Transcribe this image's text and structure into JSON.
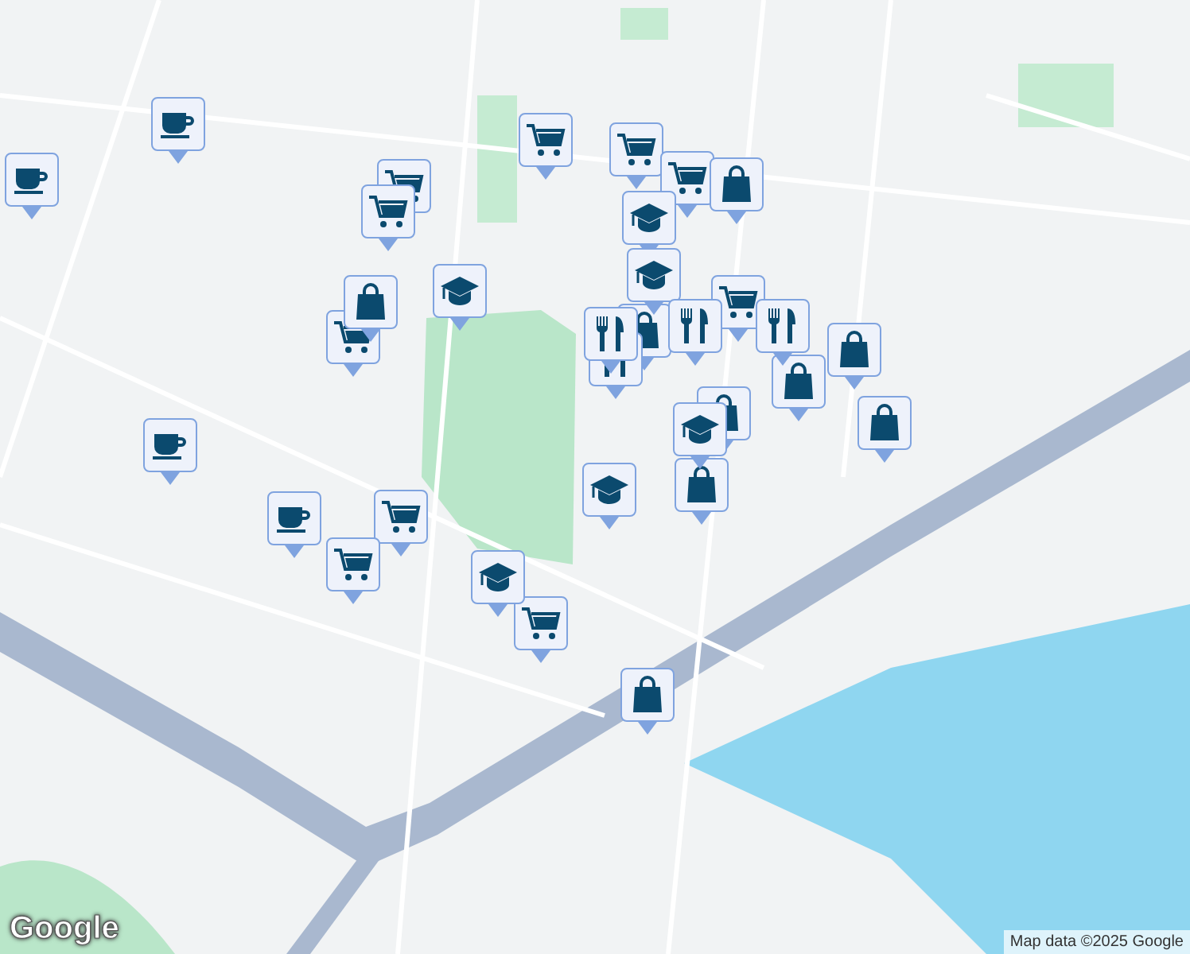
{
  "map": {
    "pins": [
      {
        "kind": "cafe"
      },
      {
        "kind": "cafe"
      },
      {
        "kind": "cafe"
      },
      {
        "kind": "cafe"
      },
      {
        "kind": "grocery"
      },
      {
        "kind": "grocery"
      },
      {
        "kind": "grocery"
      },
      {
        "kind": "grocery"
      },
      {
        "kind": "grocery"
      },
      {
        "kind": "grocery"
      },
      {
        "kind": "grocery"
      },
      {
        "kind": "grocery"
      },
      {
        "kind": "grocery"
      },
      {
        "kind": "grocery"
      },
      {
        "kind": "shop"
      },
      {
        "kind": "shop"
      },
      {
        "kind": "shop"
      },
      {
        "kind": "shop"
      },
      {
        "kind": "shop"
      },
      {
        "kind": "shop"
      },
      {
        "kind": "shop"
      },
      {
        "kind": "shop"
      },
      {
        "kind": "shop"
      },
      {
        "kind": "school"
      },
      {
        "kind": "school"
      },
      {
        "kind": "school"
      },
      {
        "kind": "school"
      },
      {
        "kind": "school"
      },
      {
        "kind": "school"
      },
      {
        "kind": "restaurant"
      },
      {
        "kind": "restaurant"
      },
      {
        "kind": "restaurant"
      },
      {
        "kind": "restaurant"
      }
    ]
  },
  "logo": "Google",
  "attribution": "Map data ©2025 Google"
}
